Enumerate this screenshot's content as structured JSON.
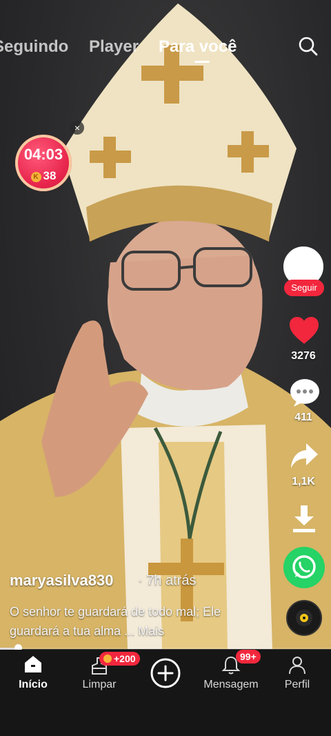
{
  "tabs": [
    {
      "label": "Seguindo"
    },
    {
      "label": "Player"
    },
    {
      "label": "Para você",
      "active": true
    }
  ],
  "timer": {
    "time": "04:03",
    "coins": "38",
    "coin_symbol": "K"
  },
  "sidebar": {
    "follow_label": "Seguir",
    "likes": "3276",
    "comments": "411",
    "shares": "1,1K"
  },
  "post": {
    "author": "maryasilva830",
    "time_ago": "· 7h atrás",
    "caption": "O senhor te guardará de todo mal; Ele guardará a tua alma",
    "more_label": "... Mais"
  },
  "progress": {
    "fraction": 0.05
  },
  "bottom_nav": {
    "items": [
      {
        "label": "Início",
        "icon": "home-icon",
        "active": true
      },
      {
        "label": "Limpar",
        "icon": "broom-icon",
        "badge": "+200"
      },
      {
        "label": "",
        "icon": "plus-icon"
      },
      {
        "label": "Mensagem",
        "icon": "bell-icon",
        "badge": "99+"
      },
      {
        "label": "Perfil",
        "icon": "person-icon"
      }
    ]
  },
  "colors": {
    "accent": "#f2273d",
    "like": "#f2273d",
    "whatsapp": "#25d366",
    "background": "#15171b"
  }
}
